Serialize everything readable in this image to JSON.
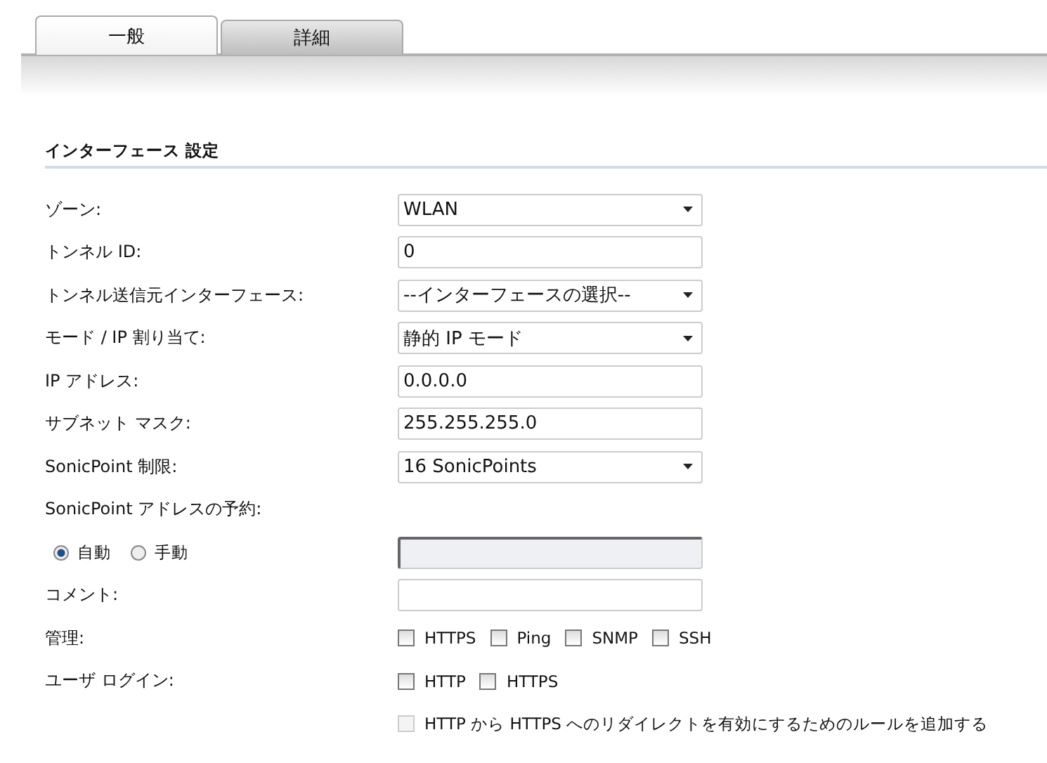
{
  "tabs": [
    {
      "label": "一般",
      "selected": true
    },
    {
      "label": "詳細",
      "selected": false
    }
  ],
  "section_title": "インターフェース 設定",
  "rows": [
    {
      "kind": "select",
      "label": "ゾーン:",
      "value": "WLAN"
    },
    {
      "kind": "text",
      "label": "トンネル ID:",
      "value": "0"
    },
    {
      "kind": "select",
      "label": "トンネル送信元インターフェース:",
      "value": "--インターフェースの選択--"
    },
    {
      "kind": "select",
      "label": "モード / IP 割り当て:",
      "value": "静的 IP モード"
    },
    {
      "kind": "text",
      "label": "IP アドレス:",
      "value": "0.0.0.0"
    },
    {
      "kind": "text",
      "label": "サブネット マスク:",
      "value": "255.255.255.0"
    },
    {
      "kind": "select",
      "label": "SonicPoint 制限:",
      "value": "16 SonicPoints"
    },
    {
      "kind": "heading",
      "label": "SonicPoint アドレスの予約:"
    },
    {
      "kind": "radio",
      "options": [
        {
          "label": "自動",
          "selected": true
        },
        {
          "label": "手動",
          "selected": false
        }
      ],
      "field_disabled": true
    },
    {
      "kind": "text",
      "label": "コメント:"
    },
    {
      "kind": "checks",
      "label": "管理:",
      "options": [
        {
          "label": "HTTPS",
          "checked": false,
          "disabled": false
        },
        {
          "label": "Ping",
          "checked": false,
          "disabled": false
        },
        {
          "label": "SNMP",
          "checked": false,
          "disabled": false
        },
        {
          "label": "SSH",
          "checked": false,
          "disabled": false
        }
      ]
    },
    {
      "kind": "checks",
      "label": "ユーザ ログイン:",
      "options": [
        {
          "label": "HTTP",
          "checked": false,
          "disabled": false
        },
        {
          "label": "HTTPS",
          "checked": false,
          "disabled": false
        }
      ]
    },
    {
      "kind": "checks",
      "options": [
        {
          "label": "HTTP から HTTPS へのリダイレクトを有効にするためのルールを追加する",
          "checked": false,
          "disabled": true
        }
      ]
    }
  ]
}
